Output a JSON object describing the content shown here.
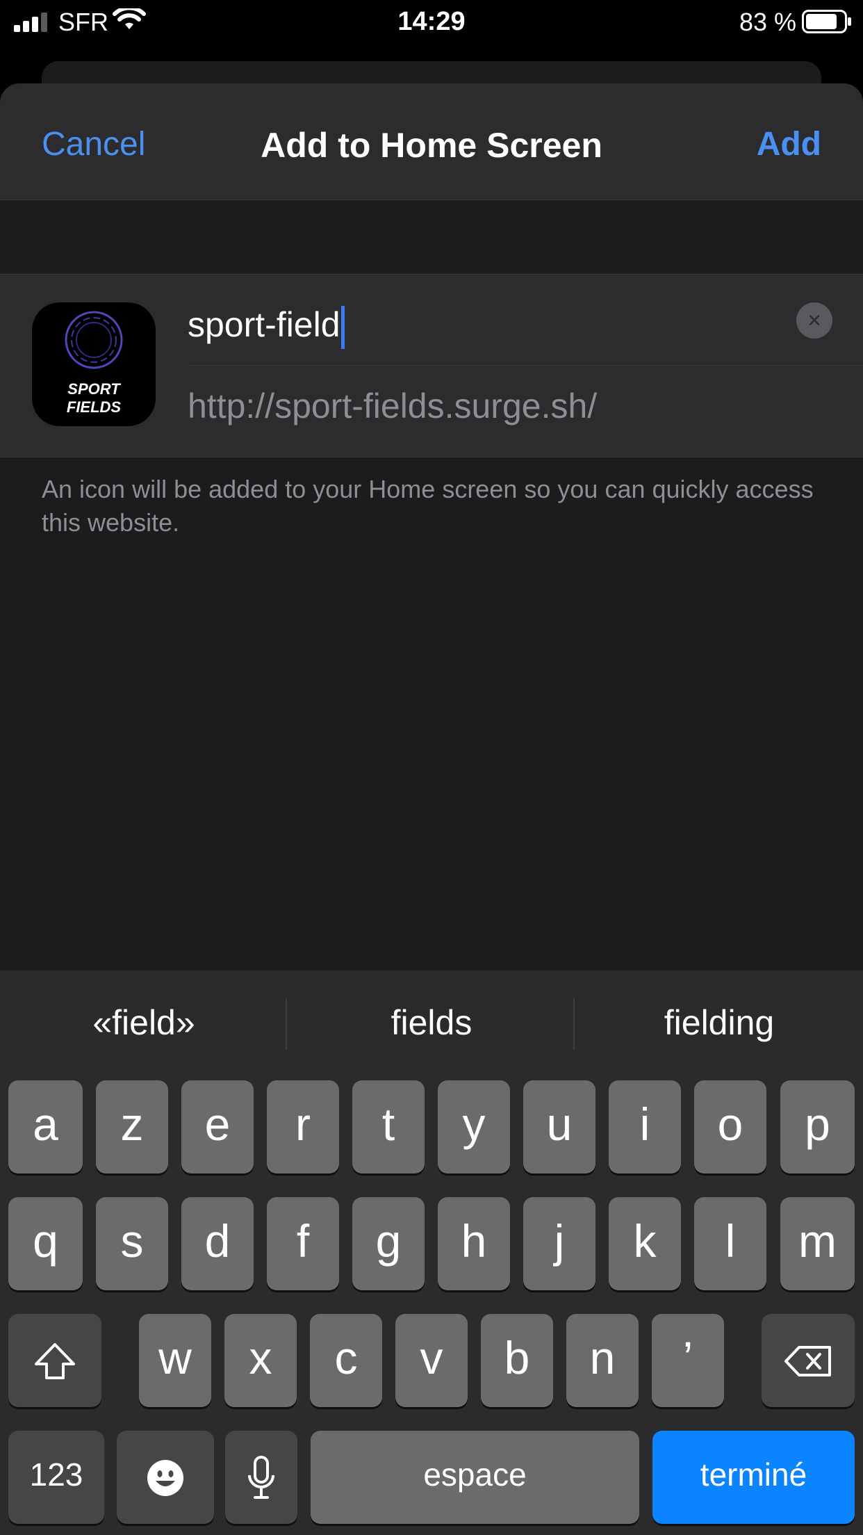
{
  "status_bar": {
    "carrier": "SFR",
    "time": "14:29",
    "battery_percent": "83 %",
    "battery_level": 0.83,
    "icons": [
      "cellular-signal-icon",
      "wifi-icon",
      "battery-icon"
    ]
  },
  "nav": {
    "cancel_label": "Cancel",
    "title": "Add to Home Screen",
    "add_label": "Add"
  },
  "form": {
    "app_icon_text": "SPORT FIELDS",
    "name_value": "sport-field",
    "url": "http://sport-fields.surge.sh/",
    "clear_icon": "×"
  },
  "info_text": "An icon will be added to your Home screen so you can quickly access this website.",
  "keyboard": {
    "suggestions": [
      "«field»",
      "fields",
      "fielding"
    ],
    "row1": [
      "a",
      "z",
      "e",
      "r",
      "t",
      "y",
      "u",
      "i",
      "o",
      "p"
    ],
    "row2": [
      "q",
      "s",
      "d",
      "f",
      "g",
      "h",
      "j",
      "k",
      "l",
      "m"
    ],
    "row3": [
      "w",
      "x",
      "c",
      "v",
      "b",
      "n",
      "’"
    ],
    "numbers_label": "123",
    "space_label": "espace",
    "done_label": "terminé"
  },
  "colors": {
    "accent": "#4a90f0",
    "done_key": "#0a84ff",
    "sheet_bg": "#1c1c1e",
    "card_bg": "#2c2c2e"
  }
}
